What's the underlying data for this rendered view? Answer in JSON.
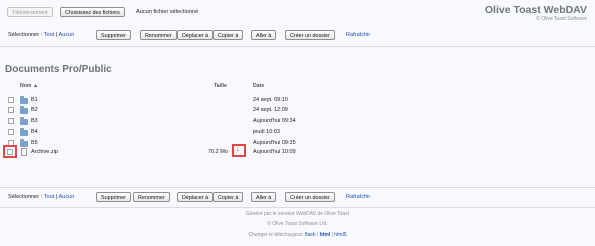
{
  "header": {
    "upload_button": "Téléversement",
    "choose_button": "Choisissez des fichiers",
    "no_file": "Aucun fichier sélectionné",
    "brand": "Olive Toast WebDAV",
    "copyright": "© Olive Toast Software"
  },
  "toolbar": {
    "select_label": "Sélectionner :",
    "all": "Tout",
    "none": "Aucun",
    "separator": "|",
    "delete": "Supprimer",
    "rename": "Renommer",
    "move": "Déplacer à",
    "copy": "Copier à",
    "goto": "Aller à",
    "create_folder": "Créer un dossier",
    "refresh": "Rafraîchir"
  },
  "section_title": "Documents Pro/Public",
  "columns": {
    "name": "Nom ▲",
    "size": "Taille",
    "date": "Date"
  },
  "rows": [
    {
      "type": "folder",
      "name": "B1",
      "size": "",
      "date": "24 sept. 09:10"
    },
    {
      "type": "folder",
      "name": "B2",
      "size": "",
      "date": "24 sept. 12:09"
    },
    {
      "type": "folder",
      "name": "B3",
      "size": "",
      "date": "Aujourd'hui 09:34"
    },
    {
      "type": "folder",
      "name": "B4",
      "size": "",
      "date": "jeudi 10:03"
    },
    {
      "type": "folder",
      "name": "B5",
      "size": "",
      "date": "Aujourd'hui 09:35"
    },
    {
      "type": "file",
      "name": "Archive.zip",
      "size": "70.2 Mo",
      "date": "Aujourd'hui 10:09"
    }
  ],
  "download_icon": "↓",
  "footer": {
    "line1": "Généré par le serveur WebDAV de Olive Toast",
    "line2": "© Olive Toast Software Ltd.",
    "line3_prefix": "Changer le téléchargeur:",
    "flash": "flash",
    "html": "html",
    "html5": "html5",
    "sep": "|"
  }
}
